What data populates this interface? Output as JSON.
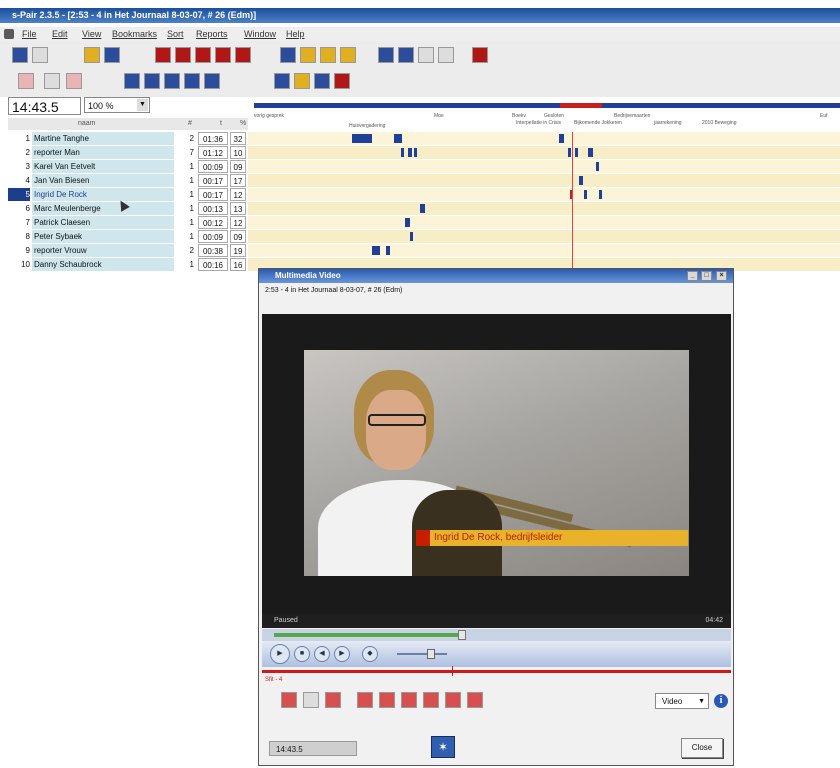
{
  "window": {
    "title": "s-Pair 2.3.5 - [2:53 - 4 in Het Journaal 8-03-07, # 26 (Edm)]"
  },
  "menu": [
    "File",
    "Edit",
    "View",
    "Bookmarks",
    "Sort",
    "Reports",
    "Window",
    "Help"
  ],
  "time_display": "14:43.5",
  "zoom": "100 %",
  "table": {
    "headers": [
      "naam",
      "#",
      "t",
      "%"
    ],
    "rows": [
      {
        "num": "1",
        "name": "Martine Tanghe",
        "count": "2",
        "duration": "01:36",
        "pct": "32"
      },
      {
        "num": "2",
        "name": "reporter Man",
        "count": "7",
        "duration": "01:12",
        "pct": "10"
      },
      {
        "num": "3",
        "name": "Karel Van Eetvelt",
        "count": "1",
        "duration": "00:09",
        "pct": "09"
      },
      {
        "num": "4",
        "name": "Jan Van Biesen",
        "count": "1",
        "duration": "00:17",
        "pct": "17"
      },
      {
        "num": "5",
        "name": "Ingrid De Rock",
        "count": "1",
        "duration": "00:17",
        "pct": "12"
      },
      {
        "num": "6",
        "name": "Marc Meulenberge",
        "count": "1",
        "duration": "00:13",
        "pct": "13"
      },
      {
        "num": "7",
        "name": "Patrick Claesen",
        "count": "1",
        "duration": "00:12",
        "pct": "12"
      },
      {
        "num": "8",
        "name": "Peter Sybaek",
        "count": "1",
        "duration": "00:09",
        "pct": "09"
      },
      {
        "num": "9",
        "name": "reporter Vrouw",
        "count": "2",
        "duration": "00:38",
        "pct": "19"
      },
      {
        "num": "10",
        "name": "Danny Schaubrock",
        "count": "1",
        "duration": "00:16",
        "pct": "16"
      }
    ]
  },
  "timeline": {
    "labels": [
      "vorig gesprek",
      "Huisvergadering",
      "Interpellatie in Crisis",
      "Boekv",
      "Moe",
      "Gesloten",
      "Bijkomende Jokkeren",
      "Bedrijvemaarten",
      "jaarrekening",
      "2010 Beweging",
      "Euf"
    ]
  },
  "dialog": {
    "title": "Multimedia Video",
    "subtitle": "2:53 - 4 in Het Journaal 8-03-07, # 26 (Edm)",
    "caption": "Ingrid De Rock, bedrijfsleider",
    "status_left": "Paused",
    "status_right": "04:42",
    "red_label": "Sfit - 4",
    "video_select": "Video",
    "timecode": "14:43.5",
    "close_label": "Close"
  }
}
